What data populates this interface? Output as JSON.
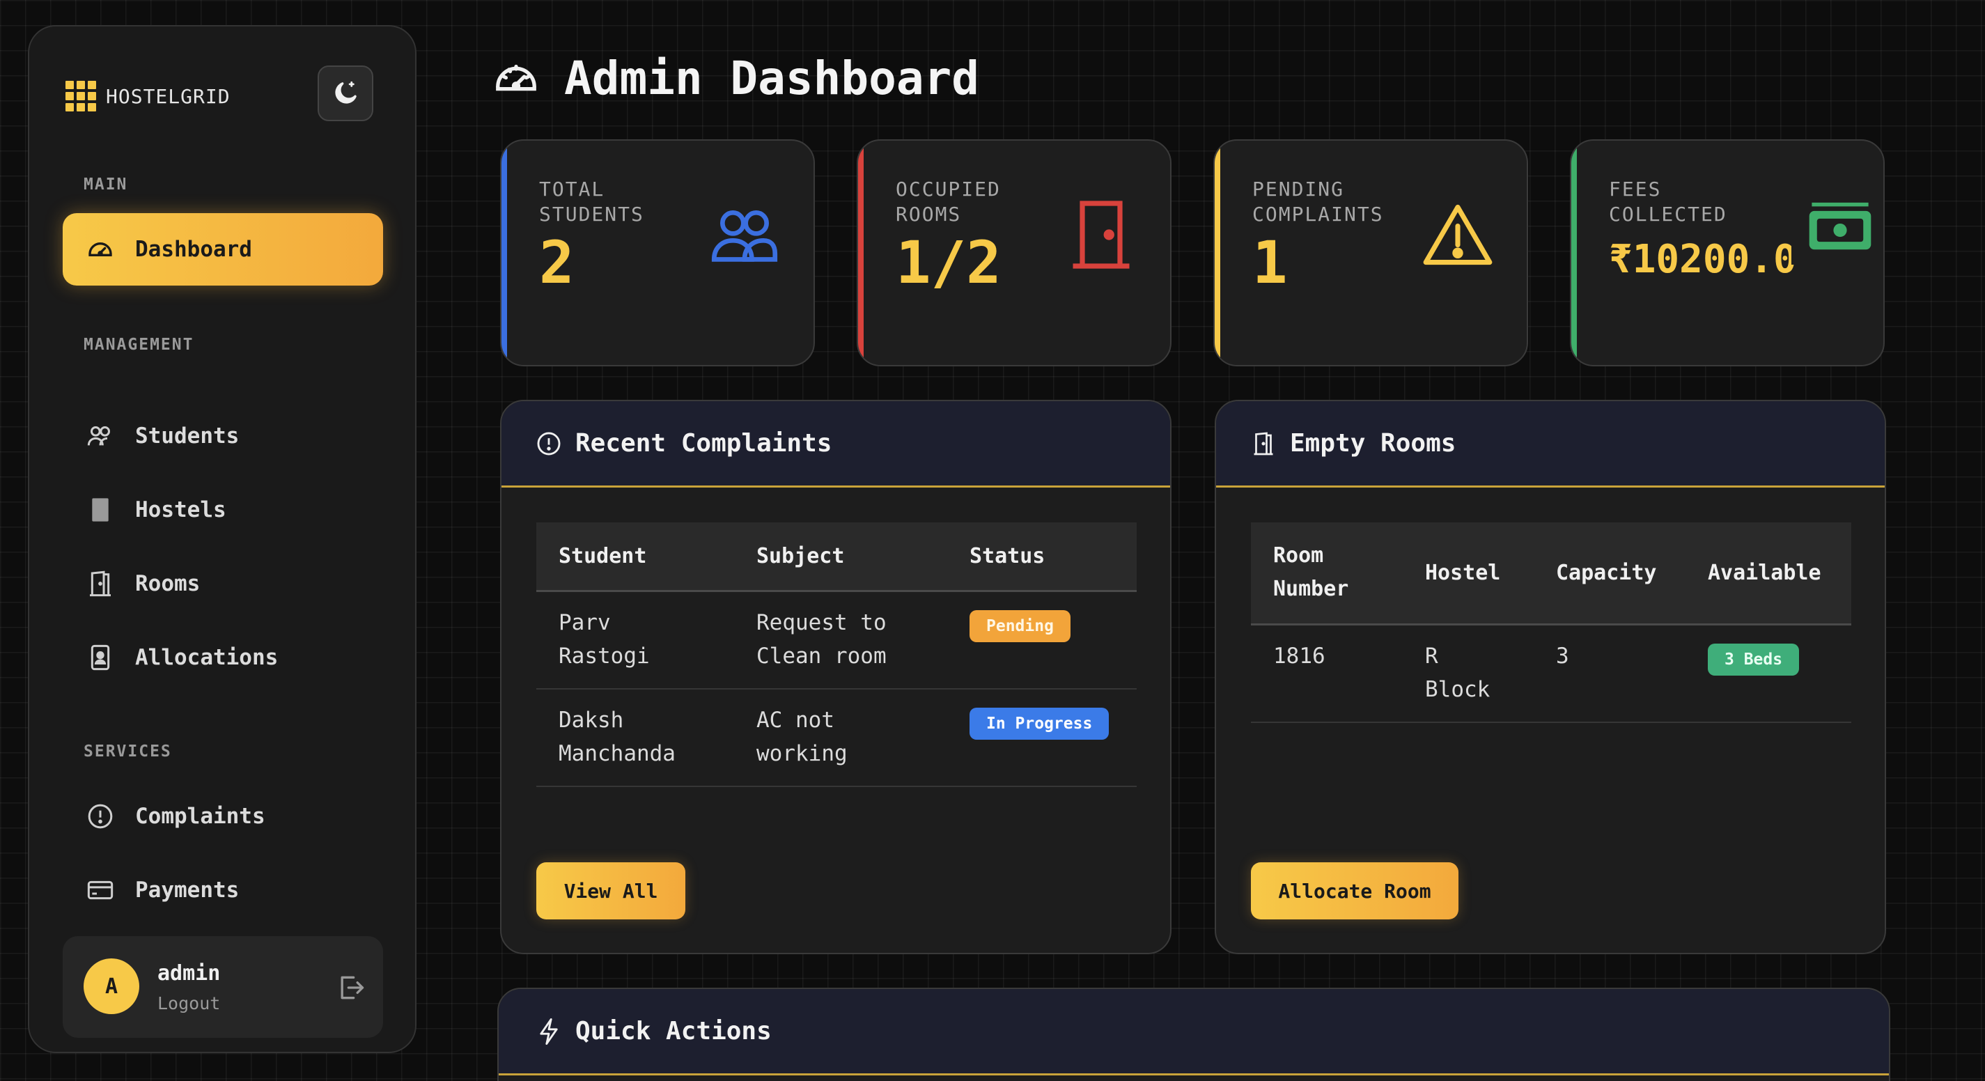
{
  "brand": {
    "name": "HOSTELGRID"
  },
  "sidebar": {
    "sections": [
      "MAIN",
      "MANAGEMENT",
      "SERVICES"
    ],
    "items": [
      {
        "label": "Dashboard",
        "icon": "gauge-icon",
        "active": true
      },
      {
        "label": "Students",
        "icon": "users-icon"
      },
      {
        "label": "Hostels",
        "icon": "building-icon"
      },
      {
        "label": "Rooms",
        "icon": "door-icon"
      },
      {
        "label": "Allocations",
        "icon": "id-card-icon"
      },
      {
        "label": "Complaints",
        "icon": "alert-circle-icon"
      },
      {
        "label": "Payments",
        "icon": "credit-card-icon"
      }
    ]
  },
  "user": {
    "avatar_letter": "A",
    "name": "admin",
    "action": "Logout"
  },
  "page": {
    "title": "Admin Dashboard"
  },
  "stats": [
    {
      "label": "TOTAL STUDENTS",
      "value": "2",
      "icon": "users-icon",
      "color": "#3b6fe0"
    },
    {
      "label": "OCCUPIED ROOMS",
      "value": "1/2",
      "icon": "door-icon",
      "color": "#d8423c"
    },
    {
      "label": "PENDING COMPLAINTS",
      "value": "1",
      "icon": "warning-icon",
      "color": "#f7c948"
    },
    {
      "label": "FEES COLLECTED",
      "value": "₹10200.0",
      "icon": "money-icon",
      "color": "#3fae6a"
    }
  ],
  "complaints": {
    "title": "Recent Complaints",
    "headers": [
      "Student",
      "Subject",
      "Status"
    ],
    "rows": [
      {
        "student": "Parv Rastogi",
        "subject": "Request to Clean room",
        "status": "Pending"
      },
      {
        "student": "Daksh Manchanda",
        "subject": "AC not working",
        "status": "In Progress"
      }
    ],
    "button": "View All"
  },
  "rooms": {
    "title": "Empty Rooms",
    "headers": [
      "Room Number",
      "Hostel",
      "Capacity",
      "Available"
    ],
    "rows": [
      {
        "room": "1816",
        "hostel": "R Block",
        "capacity": "3",
        "available": "3 Beds"
      }
    ],
    "button": "Allocate Room"
  },
  "quick_actions": {
    "title": "Quick Actions"
  }
}
